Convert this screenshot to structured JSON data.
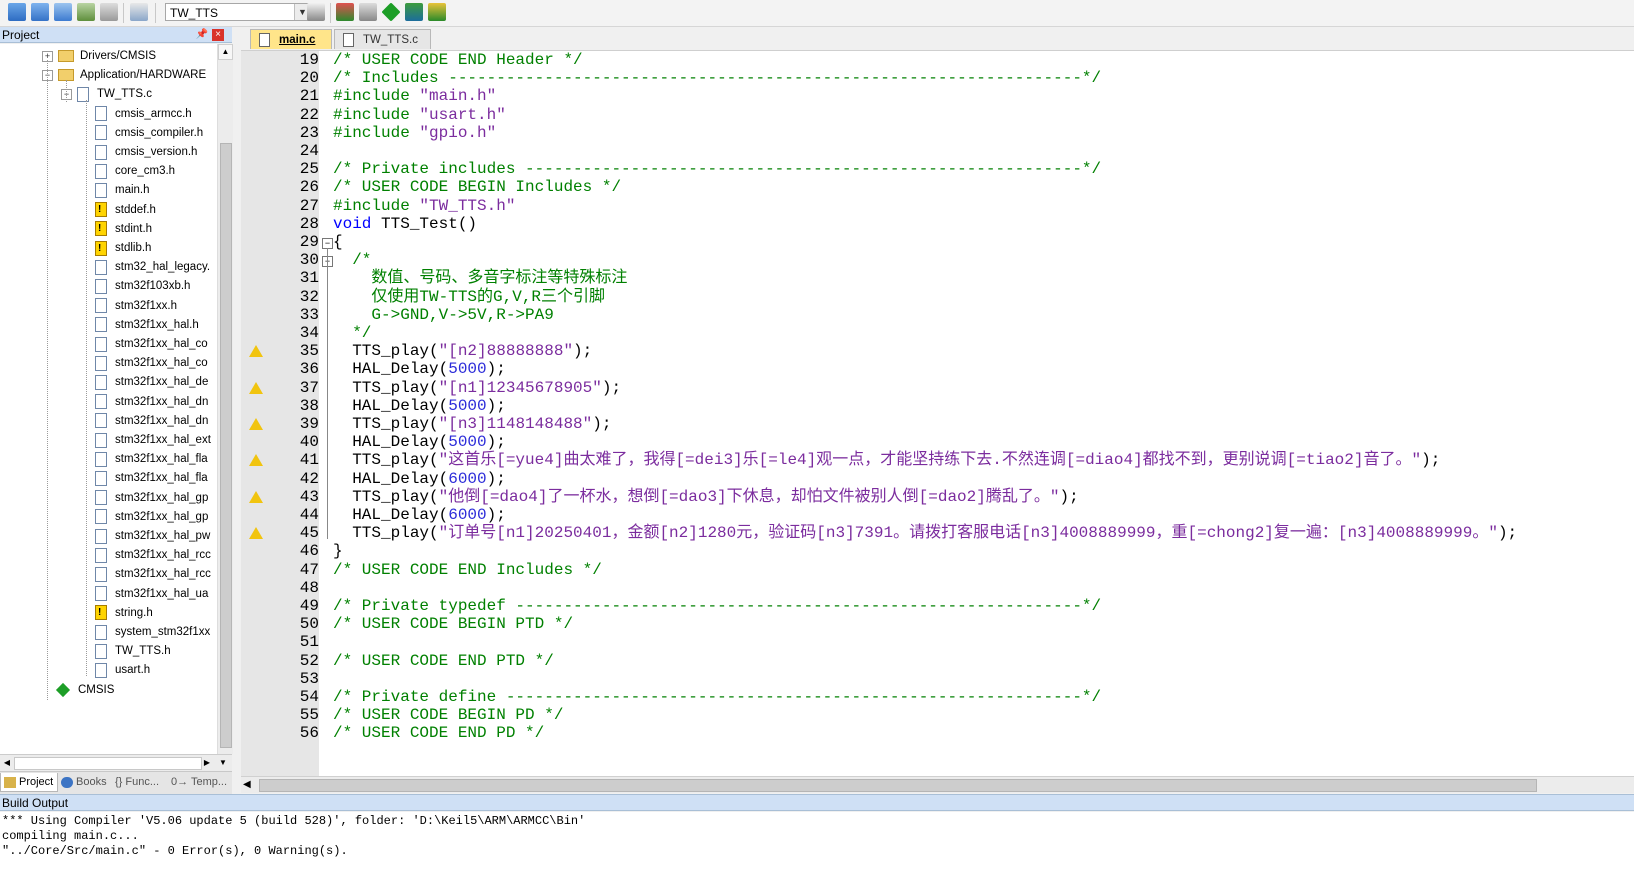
{
  "toolbar": {
    "target": "TW_TTS",
    "icons": [
      "translate-icon",
      "build-icon",
      "rebuild-icon",
      "batch-build-icon",
      "stop-build-icon",
      "download-icon",
      "target-options-icon",
      "manage-components-icon",
      "file-extensions-icon",
      "select-packs-icon",
      "pack-installer-icon"
    ]
  },
  "project_panel": {
    "title": "Project",
    "tree": [
      {
        "label": "Drivers/CMSIS",
        "type": "folder",
        "level": 1,
        "expanded": false
      },
      {
        "label": "Application/HARDWARE",
        "type": "folder",
        "level": 1,
        "expanded": true
      },
      {
        "label": "TW_TTS.c",
        "type": "file",
        "level": 2,
        "expanded": true
      },
      {
        "label": "cmsis_armcc.h",
        "type": "header",
        "level": 3
      },
      {
        "label": "cmsis_compiler.h",
        "type": "header",
        "level": 3
      },
      {
        "label": "cmsis_version.h",
        "type": "header",
        "level": 3
      },
      {
        "label": "core_cm3.h",
        "type": "header",
        "level": 3
      },
      {
        "label": "main.h",
        "type": "header",
        "level": 3
      },
      {
        "label": "stddef.h",
        "type": "header-warn",
        "level": 3
      },
      {
        "label": "stdint.h",
        "type": "header-warn",
        "level": 3
      },
      {
        "label": "stdlib.h",
        "type": "header-warn",
        "level": 3
      },
      {
        "label": "stm32_hal_legacy.",
        "type": "header",
        "level": 3
      },
      {
        "label": "stm32f103xb.h",
        "type": "header",
        "level": 3
      },
      {
        "label": "stm32f1xx.h",
        "type": "header",
        "level": 3
      },
      {
        "label": "stm32f1xx_hal.h",
        "type": "header",
        "level": 3
      },
      {
        "label": "stm32f1xx_hal_co",
        "type": "header",
        "level": 3
      },
      {
        "label": "stm32f1xx_hal_co",
        "type": "header",
        "level": 3
      },
      {
        "label": "stm32f1xx_hal_de",
        "type": "header",
        "level": 3
      },
      {
        "label": "stm32f1xx_hal_dn",
        "type": "header",
        "level": 3
      },
      {
        "label": "stm32f1xx_hal_dn",
        "type": "header",
        "level": 3
      },
      {
        "label": "stm32f1xx_hal_ext",
        "type": "header",
        "level": 3
      },
      {
        "label": "stm32f1xx_hal_fla",
        "type": "header",
        "level": 3
      },
      {
        "label": "stm32f1xx_hal_fla",
        "type": "header",
        "level": 3
      },
      {
        "label": "stm32f1xx_hal_gp",
        "type": "header",
        "level": 3
      },
      {
        "label": "stm32f1xx_hal_gp",
        "type": "header",
        "level": 3
      },
      {
        "label": "stm32f1xx_hal_pw",
        "type": "header",
        "level": 3
      },
      {
        "label": "stm32f1xx_hal_rcc",
        "type": "header",
        "level": 3
      },
      {
        "label": "stm32f1xx_hal_rcc",
        "type": "header",
        "level": 3
      },
      {
        "label": "stm32f1xx_hal_ua",
        "type": "header",
        "level": 3
      },
      {
        "label": "string.h",
        "type": "header-warn",
        "level": 3
      },
      {
        "label": "system_stm32f1xx",
        "type": "header",
        "level": 3
      },
      {
        "label": "TW_TTS.h",
        "type": "header",
        "level": 3
      },
      {
        "label": "usart.h",
        "type": "header",
        "level": 3
      },
      {
        "label": "CMSIS",
        "type": "component",
        "level": 1
      }
    ],
    "tabs": [
      {
        "label": "Project",
        "active": true
      },
      {
        "label": "Books",
        "active": false
      },
      {
        "label": "{} Func...",
        "active": false
      },
      {
        "label": "0→ Temp...",
        "active": false
      }
    ]
  },
  "editor": {
    "tabs": [
      {
        "label": "main.c",
        "active": true
      },
      {
        "label": "TW_TTS.c",
        "active": false
      }
    ],
    "lines": [
      {
        "n": "19",
        "warn": false,
        "text": "/* USER CODE END Header */",
        "cls": "cm"
      },
      {
        "n": "20",
        "warn": false,
        "text": "/* Includes ------------------------------------------------------------------*/",
        "cls": "cm"
      },
      {
        "n": "21",
        "warn": false,
        "pre": "#include ",
        "str": "\"main.h\"",
        "cls": "inc"
      },
      {
        "n": "22",
        "warn": false,
        "pre": "#include ",
        "str": "\"usart.h\"",
        "cls": "inc"
      },
      {
        "n": "23",
        "warn": false,
        "pre": "#include ",
        "str": "\"gpio.h\"",
        "cls": "inc"
      },
      {
        "n": "24",
        "warn": false,
        "text": "",
        "cls": "plain"
      },
      {
        "n": "25",
        "warn": false,
        "text": "/* Private includes ----------------------------------------------------------*/",
        "cls": "cm"
      },
      {
        "n": "26",
        "warn": false,
        "text": "/* USER CODE BEGIN Includes */",
        "cls": "cm"
      },
      {
        "n": "27",
        "warn": false,
        "pre": "#include ",
        "str": "\"TW_TTS.h\"",
        "cls": "inc"
      },
      {
        "n": "28",
        "warn": false,
        "kw": "void",
        "text": " TTS_Test()",
        "cls": "func"
      },
      {
        "n": "29",
        "warn": false,
        "text": "{",
        "cls": "plain",
        "fold": "open"
      },
      {
        "n": "30",
        "warn": false,
        "text": "  /*",
        "cls": "cm",
        "fold": "open"
      },
      {
        "n": "31",
        "warn": false,
        "text": "    数值、号码、多音字标注等特殊标注",
        "cls": "cm"
      },
      {
        "n": "32",
        "warn": false,
        "text": "    仅使用TW-TTS的G,V,R三个引脚",
        "cls": "cm"
      },
      {
        "n": "33",
        "warn": false,
        "text": "    G->GND,V->5V,R->PA9",
        "cls": "cm"
      },
      {
        "n": "34",
        "warn": false,
        "text": "  */",
        "cls": "cm"
      },
      {
        "n": "35",
        "warn": true,
        "call": "  TTS_play(",
        "arg": "\"[n2]88888888\"",
        "end": ");",
        "cls": "tts"
      },
      {
        "n": "36",
        "warn": false,
        "call": "  HAL_Delay(",
        "num": "5000",
        "end": ");",
        "cls": "delay"
      },
      {
        "n": "37",
        "warn": true,
        "call": "  TTS_play(",
        "arg": "\"[n1]12345678905\"",
        "end": ");",
        "cls": "tts"
      },
      {
        "n": "38",
        "warn": false,
        "call": "  HAL_Delay(",
        "num": "5000",
        "end": ");",
        "cls": "delay"
      },
      {
        "n": "39",
        "warn": true,
        "call": "  TTS_play(",
        "arg": "\"[n3]1148148488\"",
        "end": ");",
        "cls": "tts"
      },
      {
        "n": "40",
        "warn": false,
        "call": "  HAL_Delay(",
        "num": "5000",
        "end": ");",
        "cls": "delay"
      },
      {
        "n": "41",
        "warn": true,
        "call": "  TTS_play(",
        "arg": "\"这首乐[=yue4]曲太难了，我得[=dei3]乐[=le4]观一点，才能坚持练下去.不然连调[=diao4]都找不到，更别说调[=tiao2]音了。\"",
        "end": ");",
        "cls": "tts"
      },
      {
        "n": "42",
        "warn": false,
        "call": "  HAL_Delay(",
        "num": "6000",
        "end": ");",
        "cls": "delay"
      },
      {
        "n": "43",
        "warn": true,
        "call": "  TTS_play(",
        "arg": "\"他倒[=dao4]了一杯水，想倒[=dao3]下休息，却怕文件被别人倒[=dao2]腾乱了。\"",
        "end": ");",
        "cls": "tts"
      },
      {
        "n": "44",
        "warn": false,
        "call": "  HAL_Delay(",
        "num": "6000",
        "end": ");",
        "cls": "delay"
      },
      {
        "n": "45",
        "warn": true,
        "call": "  TTS_play(",
        "arg": "\"订单号[n1]20250401，金额[n2]1280元，验证码[n3]7391。请拨打客服电话[n3]4008889999，重[=chong2]复一遍：[n3]4008889999。\"",
        "end": ");",
        "cls": "tts"
      },
      {
        "n": "46",
        "warn": false,
        "text": "}",
        "cls": "plain",
        "fold": "end"
      },
      {
        "n": "47",
        "warn": false,
        "text": "/* USER CODE END Includes */",
        "cls": "cm"
      },
      {
        "n": "48",
        "warn": false,
        "text": "",
        "cls": "plain"
      },
      {
        "n": "49",
        "warn": false,
        "text": "/* Private typedef -----------------------------------------------------------*/",
        "cls": "cm"
      },
      {
        "n": "50",
        "warn": false,
        "text": "/* USER CODE BEGIN PTD */",
        "cls": "cm"
      },
      {
        "n": "51",
        "warn": false,
        "text": "",
        "cls": "plain"
      },
      {
        "n": "52",
        "warn": false,
        "text": "/* USER CODE END PTD */",
        "cls": "cm"
      },
      {
        "n": "53",
        "warn": false,
        "text": "",
        "cls": "plain"
      },
      {
        "n": "54",
        "warn": false,
        "text": "/* Private define ------------------------------------------------------------*/",
        "cls": "cm"
      },
      {
        "n": "55",
        "warn": false,
        "text": "/* USER CODE BEGIN PD */",
        "cls": "cm"
      },
      {
        "n": "56",
        "warn": false,
        "text": "/* USER CODE END PD */",
        "cls": "cm"
      }
    ]
  },
  "build_output": {
    "title": "Build Output",
    "lines": [
      "*** Using Compiler 'V5.06 update 5 (build 528)', folder: 'D:\\Keil5\\ARM\\ARMCC\\Bin'",
      "compiling main.c...",
      "\"../Core/Src/main.c\" - 0 Error(s), 0 Warning(s)."
    ]
  },
  "colors": {
    "comment": "#008000",
    "keyword": "#0000ff",
    "string": "#7b2c9e",
    "number": "#2b2bd9",
    "active_tab": "#ffe58a",
    "panel_header": "#cfe0f5"
  }
}
